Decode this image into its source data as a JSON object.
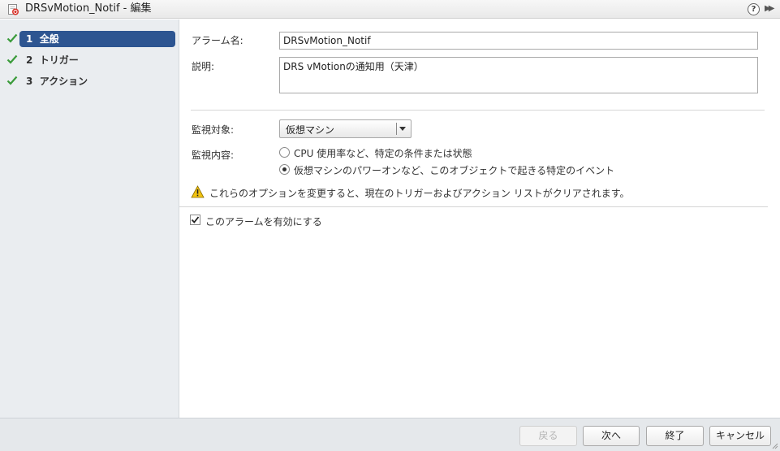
{
  "window": {
    "title": "DRSvMotion_Notif - 編集",
    "help_glyph": "?",
    "expand_glyph": "▶▶"
  },
  "sidebar": {
    "steps": [
      {
        "number": "1",
        "label": "全般",
        "state": "active",
        "completed": true
      },
      {
        "number": "2",
        "label": "トリガー",
        "state": "inactive",
        "completed": true
      },
      {
        "number": "3",
        "label": "アクション",
        "state": "inactive",
        "completed": true
      }
    ]
  },
  "general": {
    "alarm_name_label": "アラーム名:",
    "alarm_name_value": "DRSvMotion_Notif",
    "description_label": "説明:",
    "description_value": "DRS vMotionの通知用（天津）",
    "monitor_target_label": "監視対象:",
    "monitor_target_value": "仮想マシン",
    "monitor_content_label": "監視内容:",
    "options": [
      {
        "label": "CPU 使用率など、特定の条件または状態",
        "selected": false
      },
      {
        "label": "仮想マシンのパワーオンなど、このオブジェクトで起きる特定のイベント",
        "selected": true
      }
    ],
    "warning_text": "これらのオプションを変更すると、現在のトリガーおよびアクション リストがクリアされます。",
    "enable_label": "このアラームを有効にする",
    "enable_checked": true
  },
  "footer": {
    "back_label": "戻る",
    "next_label": "次へ",
    "finish_label": "終了",
    "cancel_label": "キャンセル"
  },
  "colors": {
    "active_step": "#2d5591",
    "check_green": "#3a9b3a",
    "warning_yellow": "#f2c311"
  }
}
